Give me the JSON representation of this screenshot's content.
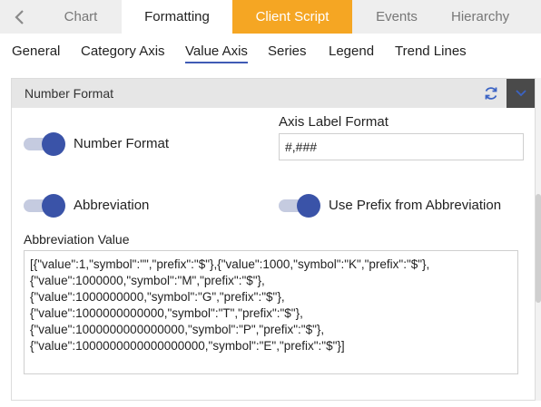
{
  "top_tabs": {
    "chart": "Chart",
    "formatting": "Formatting",
    "client_script": "Client Script",
    "events": "Events",
    "hierarchy": "Hierarchy"
  },
  "sub_tabs": {
    "general": "General",
    "category_axis": "Category Axis",
    "value_axis": "Value Axis",
    "series": "Series",
    "legend": "Legend",
    "trend_lines": "Trend Lines",
    "active": "Value Axis"
  },
  "panel": {
    "title": "Number Format",
    "number_format_label": "Number Format",
    "number_format_on": true,
    "axis_label_format_title": "Axis Label Format",
    "axis_label_format_value": "#,###",
    "abbreviation_label": "Abbreviation",
    "abbreviation_on": true,
    "use_prefix_label": "Use Prefix from Abbreviation",
    "use_prefix_on": true,
    "abbreviation_value_title": "Abbreviation Value",
    "abbreviation_value": "[{\"value\":1,\"symbol\":\"\",\"prefix\":\"$\"},{\"value\":1000,\"symbol\":\"K\",\"prefix\":\"$\"},\n{\"value\":1000000,\"symbol\":\"M\",\"prefix\":\"$\"},\n{\"value\":1000000000,\"symbol\":\"G\",\"prefix\":\"$\"},\n{\"value\":1000000000000,\"symbol\":\"T\",\"prefix\":\"$\"},\n{\"value\":1000000000000000,\"symbol\":\"P\",\"prefix\":\"$\"},\n{\"value\":1000000000000000000,\"symbol\":\"E\",\"prefix\":\"$\"}]"
  },
  "icons": {
    "back": "chevron-left-icon",
    "refresh": "refresh-icon",
    "collapse": "chevron-down-icon"
  },
  "colors": {
    "accent": "#3a53a8",
    "client_script_tab": "#f5a623",
    "toggle_track": "#c5cbe0"
  }
}
